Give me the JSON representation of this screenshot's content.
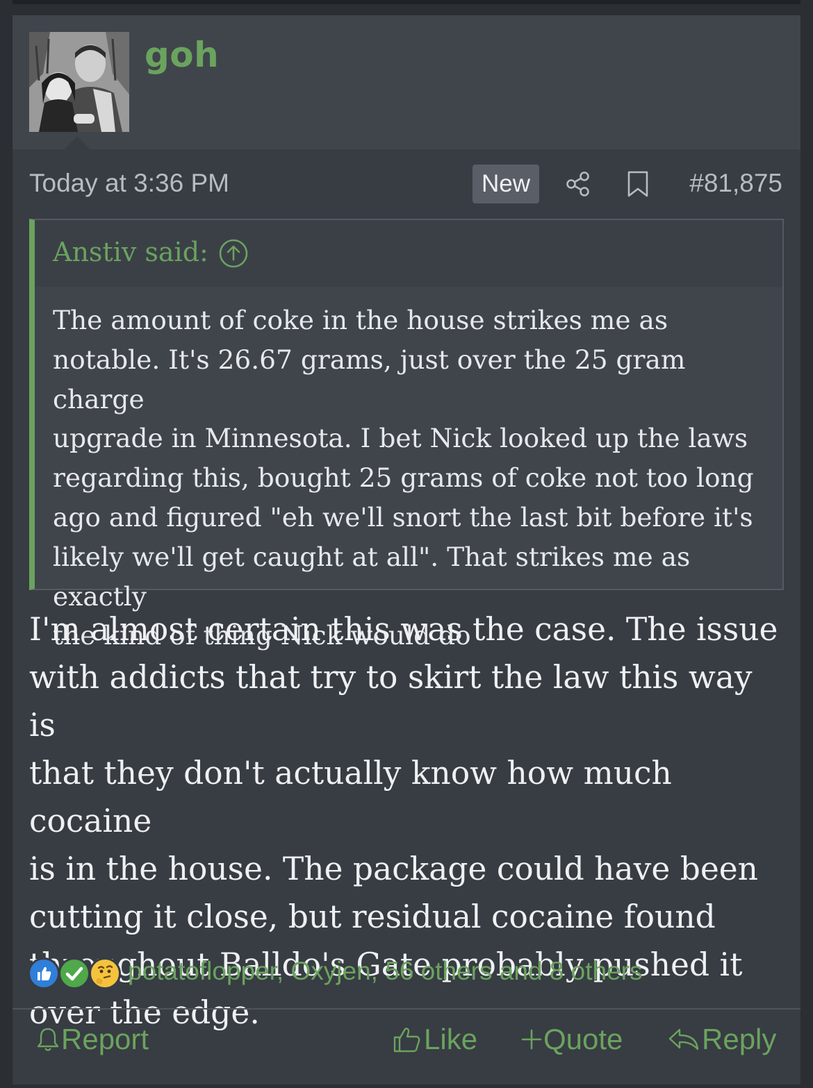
{
  "post": {
    "username": "goh",
    "date": "Today at 3:36 PM",
    "new_badge": "New",
    "post_number": "#81,875",
    "quote": {
      "author_line": "Anstiv said:",
      "lines": [
        "The amount of coke in the house strikes me as",
        "notable. It's 26.67 grams, just over the 25 gram charge",
        "upgrade in Minnesota. I bet Nick looked up the laws",
        "regarding this, bought 25 grams of coke not too long",
        "ago and figured \"eh we'll snort the last bit before it's",
        "likely we'll get caught at all\". That strikes me as exactly",
        "the kind of thing Nick would do"
      ]
    },
    "message_lines": [
      "I'm almost certain this was the case. The issue",
      "with addicts that try to skirt the law this way is",
      "that they don't actually know how much cocaine",
      "is in the house. The package could have been",
      "cutting it close, but residual cocaine found",
      "throughout Balldo's Gate probably pushed it",
      "over the edge."
    ],
    "reactions": {
      "icons": [
        "like-reaction-icon",
        "agree-check-reaction-icon",
        "thinking-face-reaction-icon"
      ],
      "summary": "potatoflopper, Oxyjen, 56 others and 8 others"
    },
    "actions": {
      "report": "Report",
      "like": "Like",
      "quote": "Quote",
      "reply": "Reply"
    }
  },
  "colors": {
    "accent": "#6aa35e",
    "background": "#383c43",
    "header": "#40454c"
  }
}
